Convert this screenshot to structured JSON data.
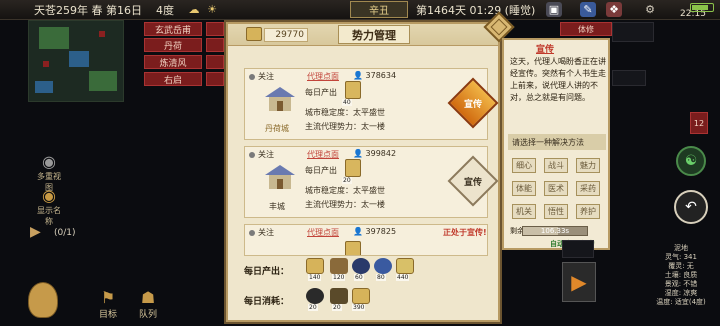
{
  "topbar": {
    "date": "天苍259年 春 第16日",
    "temp": "4度",
    "ganzhi": "辛丑",
    "days": "第1464天 01:29 (睡觉)",
    "clock": "22:15"
  },
  "map_tags": [
    "玄武岳甫",
    "丹荷",
    "炼清风",
    "右启"
  ],
  "left_panel": {
    "multi_view": "多重视图",
    "show_names": "显示名称",
    "count": "(0/1)"
  },
  "nav": {
    "target": "目标",
    "team": "队列"
  },
  "panel": {
    "title": "势力管理",
    "gold": "29770",
    "follow": "关注",
    "daily_output_label": "每日产出",
    "preach": "宣传",
    "in_preach": "正处于宣传!",
    "cards": [
      {
        "name": "代理点面",
        "population": "378634",
        "coin": "40",
        "stability": "城市稳定度：太平盛世",
        "agent": "主流代理势力：太一楼",
        "city": "丹荷城",
        "active": true
      },
      {
        "name": "代理点面",
        "population": "399842",
        "coin": "20",
        "stability": "城市稳定度：太平盛世",
        "agent": "主流代理势力：太一楼",
        "city": "丰城",
        "active": false
      },
      {
        "name": "代理点面",
        "population": "397825",
        "coin": "",
        "stability": "",
        "agent": "",
        "city": "",
        "active": false
      }
    ],
    "summary": {
      "output_label": "每日产出：",
      "consume_label": "每日消耗：",
      "output_values": [
        "140",
        "120",
        "60",
        "80",
        "440"
      ],
      "consume_values": [
        "20",
        "20",
        "390"
      ]
    }
  },
  "info": {
    "title": "宣传",
    "text": "这天，代理人喝盼香正在讲经宣传。突然有个人书生走上前来，说代理人讲的不对，总之就是有问题。",
    "solution_label": "请选择一种解决方法",
    "solutions": [
      "细心",
      "战斗",
      "魅力",
      "体能",
      "医术",
      "采药",
      "机关",
      "悟性",
      "养护"
    ],
    "cost_label": "剩余",
    "cost_value": "106.33s",
    "auto": "自动选择:魅力"
  },
  "right": {
    "badge": "12",
    "terrain": [
      "泥地",
      "灵气: 341",
      "覆灵: 无",
      "土壤: 良质",
      "景观: 不错",
      "湿度: 凉爽",
      "温度: 适宜(4度)"
    ]
  }
}
